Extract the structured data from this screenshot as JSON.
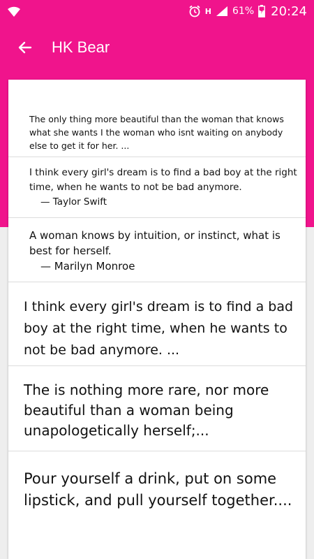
{
  "status_bar": {
    "battery": "61%",
    "time": "20:24",
    "network": "H"
  },
  "app_bar": {
    "title": "HK Bear",
    "back_icon": "arrow-left-icon"
  },
  "colors": {
    "accent": "#f0148c",
    "background": "#eeeeee",
    "card": "#ffffff",
    "text": "#111111"
  },
  "quotes": [
    {
      "text": "The only thing more beautiful than the woman that knows what she wants I the woman who isnt waiting on anybody else to get it for her. ..."
    },
    {
      "text": "I think every girl's dream is to find a bad boy at the right time, when he wants to not be bad anymore.",
      "author": "— Taylor Swift"
    },
    {
      "text": "A woman knows by intuition, or instinct, what is best for herself.",
      "author": "— Marilyn Monroe"
    },
    {
      "text": "I think every girl's dream is to find a bad boy at the right time, when he wants to not be bad anymore. ..."
    },
    {
      "text": "The is nothing more rare, nor more beautiful than a woman being unapologetically herself;..."
    },
    {
      "text": "Pour yourself a drink, put on some lipstick, and pull yourself together...."
    }
  ]
}
